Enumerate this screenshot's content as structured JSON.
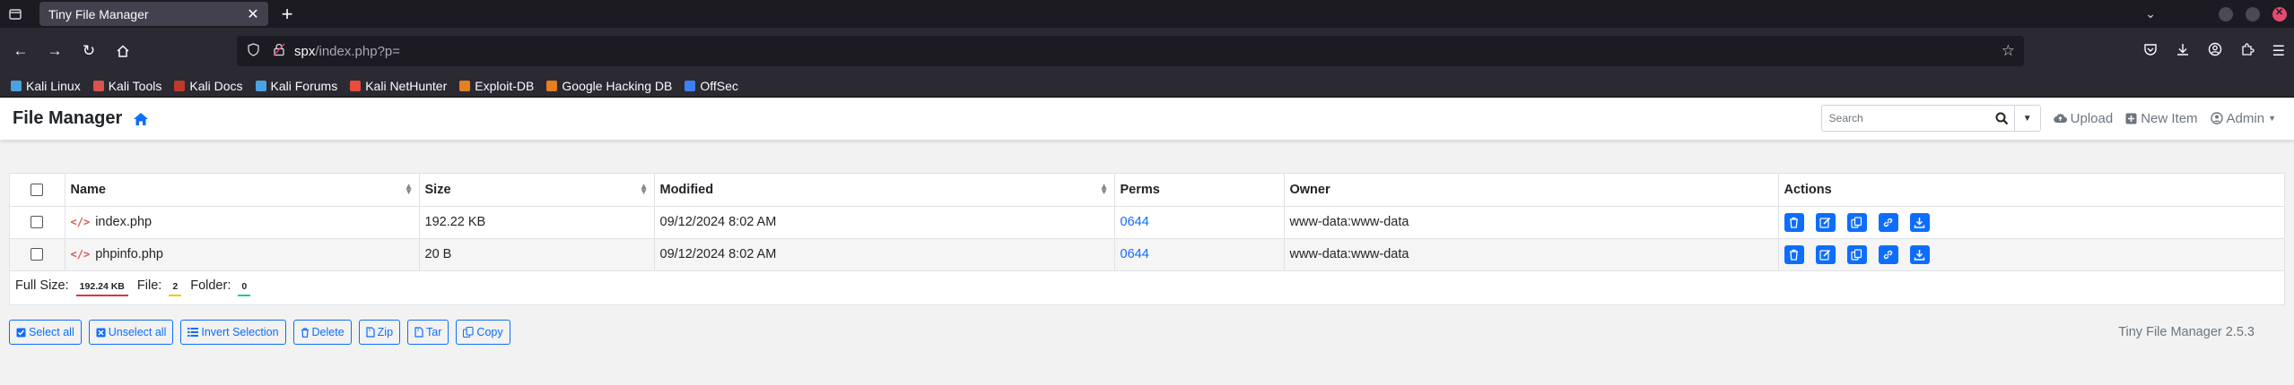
{
  "browser": {
    "tab_title": "Tiny File Manager",
    "url_host": "spx",
    "url_path": "/index.php?p=",
    "bookmarks": [
      {
        "label": "Kali Linux",
        "color": "#4aa3df"
      },
      {
        "label": "Kali Tools",
        "color": "#d9534f"
      },
      {
        "label": "Kali Docs",
        "color": "#c0392b"
      },
      {
        "label": "Kali Forums",
        "color": "#4aa3df"
      },
      {
        "label": "Kali NetHunter",
        "color": "#e74c3c"
      },
      {
        "label": "Exploit-DB",
        "color": "#e67e22"
      },
      {
        "label": "Google Hacking DB",
        "color": "#e67e22"
      },
      {
        "label": "OffSec",
        "color": "#3b82f6"
      }
    ]
  },
  "header": {
    "title": "File Manager",
    "search_placeholder": "Search",
    "upload_label": "Upload",
    "new_item_label": "New Item",
    "user_label": "Admin"
  },
  "table": {
    "columns": {
      "name": "Name",
      "size": "Size",
      "modified": "Modified",
      "perms": "Perms",
      "owner": "Owner",
      "actions": "Actions"
    },
    "rows": [
      {
        "name": "index.php",
        "size": "192.22 KB",
        "modified": "09/12/2024 8:02 AM",
        "perms": "0644",
        "owner": "www-data:www-data"
      },
      {
        "name": "phpinfo.php",
        "size": "20 B",
        "modified": "09/12/2024 8:02 AM",
        "perms": "0644",
        "owner": "www-data:www-data"
      }
    ],
    "summary": {
      "full_size_label": "Full Size:",
      "full_size_value": "192.24 KB",
      "file_label": "File:",
      "file_value": "2",
      "folder_label": "Folder:",
      "folder_value": "0"
    }
  },
  "buttons": {
    "select_all": "Select all",
    "unselect_all": "Unselect all",
    "invert_selection": "Invert Selection",
    "delete": "Delete",
    "zip": "Zip",
    "tar": "Tar",
    "copy": "Copy"
  },
  "footer": {
    "version": "Tiny File Manager 2.5.3"
  },
  "colors": {
    "accent": "#0d6efd",
    "danger": "#dc3545",
    "warning": "#ffc107",
    "success": "#20c997"
  }
}
